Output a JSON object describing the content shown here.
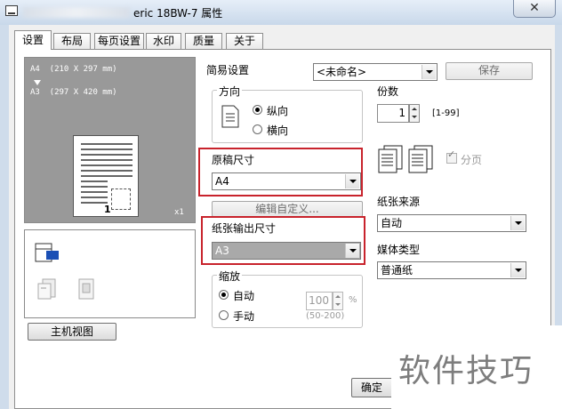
{
  "window": {
    "title": "eric 18BW-7 属性",
    "close_label": "✕"
  },
  "tabs": [
    "设置",
    "布局",
    "每页设置",
    "水印",
    "质量",
    "关于"
  ],
  "preview": {
    "line1": "A4  (210 X 297 mm)",
    "line2": "A3  (297 X 420 mm)",
    "page_number": "1",
    "zoom": "x1"
  },
  "host_view_button": "主机视图",
  "easy_setting": {
    "label": "简易设置",
    "value": "<未命名>",
    "save_label": "保存"
  },
  "orientation": {
    "title": "方向",
    "portrait": "纵向",
    "landscape": "横向",
    "selected": "portrait"
  },
  "copies": {
    "label": "份数",
    "value": "1",
    "range": "[1-99]"
  },
  "collate": {
    "label": "分页",
    "checked": true
  },
  "original_size": {
    "label": "原稿尺寸",
    "value": "A4"
  },
  "edit_custom_button": "编辑自定义...",
  "output_size": {
    "label": "纸张输出尺寸",
    "value": "A3"
  },
  "scaling": {
    "title": "缩放",
    "auto": "自动",
    "manual": "手动",
    "value": "100",
    "unit": "%",
    "range": "(50-200)",
    "selected": "auto"
  },
  "paper_source": {
    "label": "纸张来源",
    "value": "自动"
  },
  "media_type": {
    "label": "媒体类型",
    "value": "普通纸"
  },
  "ok_button": "确定",
  "watermark": "软件技巧",
  "colors": {
    "highlight": "#c8232c",
    "preview_bg": "#999999",
    "titlebar": "#cfdceb"
  }
}
